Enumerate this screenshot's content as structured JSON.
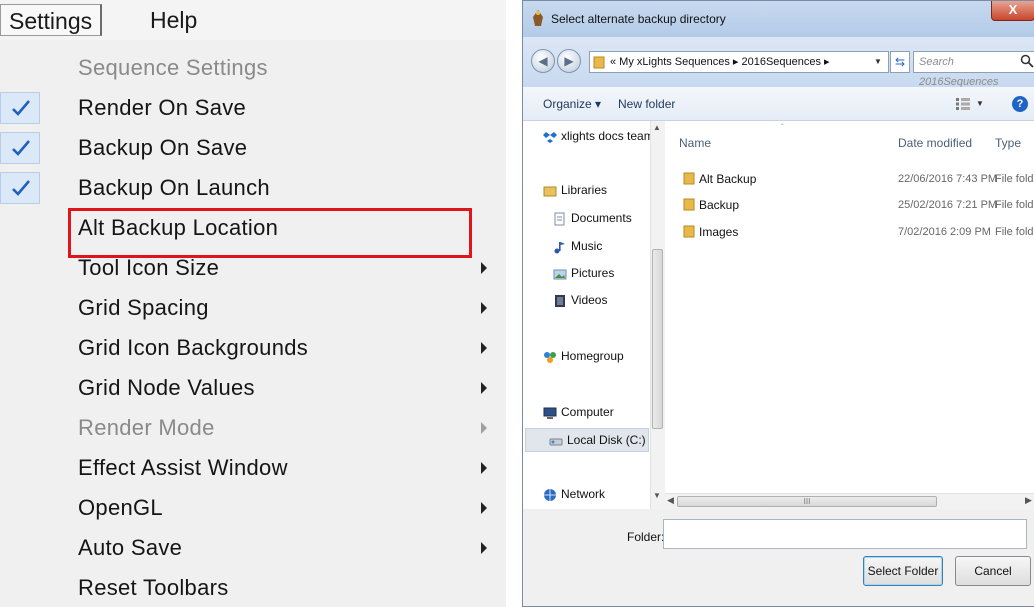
{
  "menubar": {
    "settings": "Settings",
    "help": "Help"
  },
  "menu": {
    "items": [
      {
        "label": "Sequence Settings",
        "checked": false,
        "submenu": false,
        "disabled": true
      },
      {
        "label": "Render On Save",
        "checked": true,
        "submenu": false,
        "disabled": false
      },
      {
        "label": "Backup On Save",
        "checked": true,
        "submenu": false,
        "disabled": false
      },
      {
        "label": "Backup On Launch",
        "checked": true,
        "submenu": false,
        "disabled": false
      },
      {
        "label": "Alt Backup Location",
        "checked": false,
        "submenu": false,
        "disabled": false,
        "highlighted": true
      },
      {
        "label": "Tool Icon Size",
        "checked": false,
        "submenu": true,
        "disabled": false
      },
      {
        "label": "Grid Spacing",
        "checked": false,
        "submenu": true,
        "disabled": false
      },
      {
        "label": "Grid Icon Backgrounds",
        "checked": false,
        "submenu": true,
        "disabled": false
      },
      {
        "label": "Grid Node Values",
        "checked": false,
        "submenu": true,
        "disabled": false
      },
      {
        "label": "Render Mode",
        "checked": false,
        "submenu": true,
        "disabled": true
      },
      {
        "label": "Effect Assist Window",
        "checked": false,
        "submenu": true,
        "disabled": false
      },
      {
        "label": "OpenGL",
        "checked": false,
        "submenu": true,
        "disabled": false
      },
      {
        "label": "Auto Save",
        "checked": false,
        "submenu": true,
        "disabled": false
      },
      {
        "label": "Reset Toolbars",
        "checked": false,
        "submenu": false,
        "disabled": false
      }
    ],
    "highlight_color": "#e0151c",
    "check_color": "#1f5fbf"
  },
  "dialog": {
    "title": "Select alternate backup directory",
    "close": "X",
    "address": "« My xLights Sequences ▸ 2016Sequences ▸",
    "search_placeholder": "Search 2016Sequences",
    "toolbar": {
      "organize": "Organize ▾",
      "new_folder": "New folder"
    },
    "nav": [
      {
        "label": "xlights docs team",
        "icon": "dropbox-icon"
      },
      {
        "label": "Libraries",
        "icon": "libraries-icon"
      },
      {
        "label": "Documents",
        "icon": "documents-icon"
      },
      {
        "label": "Music",
        "icon": "music-icon"
      },
      {
        "label": "Pictures",
        "icon": "pictures-icon"
      },
      {
        "label": "Videos",
        "icon": "videos-icon"
      },
      {
        "label": "Homegroup",
        "icon": "homegroup-icon"
      },
      {
        "label": "Computer",
        "icon": "computer-icon"
      },
      {
        "label": "Local Disk (C:)",
        "icon": "disk-icon",
        "selected": true
      },
      {
        "label": "Network",
        "icon": "network-icon"
      }
    ],
    "columns": {
      "name": "Name",
      "date": "Date modified",
      "type": "Type"
    },
    "files": [
      {
        "name": "Alt Backup",
        "date": "22/06/2016 7:43 PM",
        "type": "File fold"
      },
      {
        "name": "Backup",
        "date": "25/02/2016 7:21 PM",
        "type": "File fold"
      },
      {
        "name": "Images",
        "date": "7/02/2016 2:09 PM",
        "type": "File fold"
      }
    ],
    "hscroll_grip": "III",
    "folder_label": "Folder:",
    "folder_value": "",
    "buttons": {
      "select": "Select Folder",
      "cancel": "Cancel"
    }
  }
}
